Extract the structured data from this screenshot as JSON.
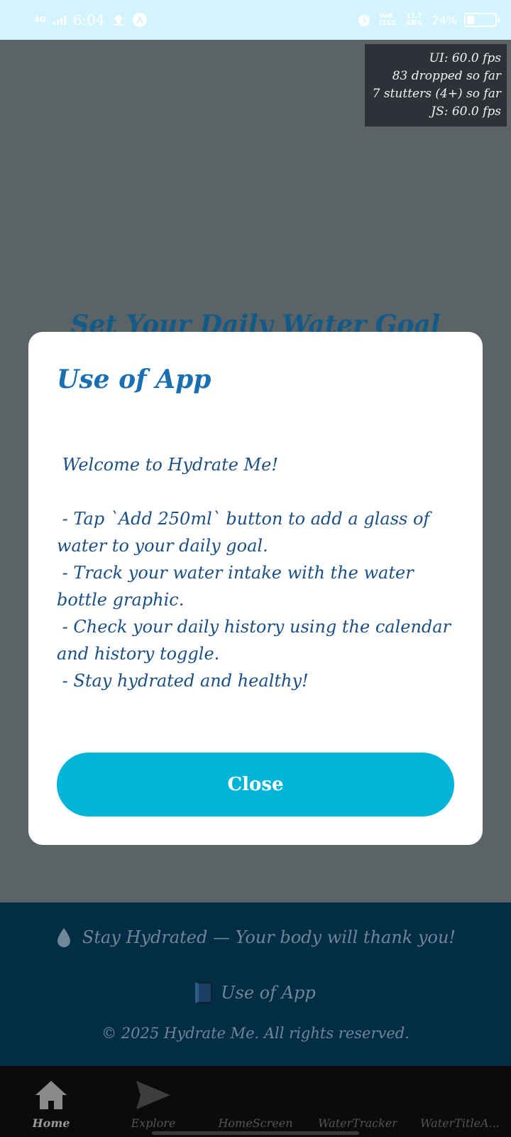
{
  "status_bar": {
    "network": "4G",
    "time": "6:04",
    "volte": "Vo8 LTE2",
    "speed": "11.7 KB/s",
    "battery_percent": "24%",
    "battery_level": 0.24
  },
  "perf_overlay": {
    "ui_fps": "UI: 60.0 fps",
    "dropped": "83 dropped so far",
    "stutters": "7 stutters (4+) so far",
    "js_fps": "JS: 60.0 fps"
  },
  "background": {
    "title": "Set Your Daily Water Goal"
  },
  "modal": {
    "title": "Use of App",
    "body": " Welcome to Hydrate Me!\n\n - Tap `Add 250ml` button to add a glass of water to your daily goal.\n - Track your water intake with the water bottle graphic.\n - Check your daily history using the calendar and history toggle.\n - Stay hydrated and healthy!",
    "close_label": "Close"
  },
  "footer": {
    "tagline": "Stay Hydrated — Your body will thank you!",
    "use_link": "Use of App",
    "copyright": "© 2025 Hydrate Me. All rights reserved."
  },
  "bottom_nav": {
    "items": [
      {
        "label": "Home",
        "icon": "home-icon",
        "active": true
      },
      {
        "label": "Explore",
        "icon": "send-icon",
        "active": false
      },
      {
        "label": "HomeScreen",
        "icon": "",
        "active": false
      },
      {
        "label": "WaterTracker",
        "icon": "",
        "active": false
      },
      {
        "label": "WaterTitleA...",
        "icon": "",
        "active": false
      }
    ]
  },
  "colors": {
    "accent": "#02b4d8",
    "modal_title": "#1a6fb3",
    "footer_bg": "#032c45"
  }
}
